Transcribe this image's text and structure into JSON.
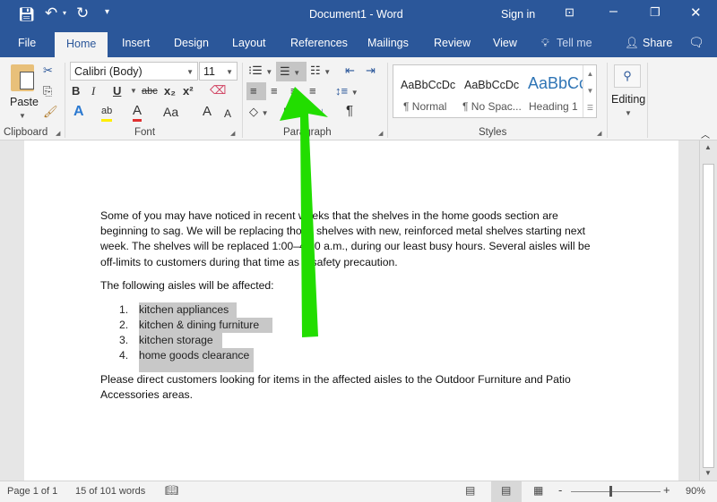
{
  "title": "Document1 - Word",
  "titlebar": {
    "sign_in": "Sign in",
    "save_icon": "save-icon",
    "undo_icon": "undo-icon",
    "redo_icon": "redo-icon"
  },
  "tabs": [
    {
      "label": "File"
    },
    {
      "label": "Home"
    },
    {
      "label": "Insert"
    },
    {
      "label": "Design"
    },
    {
      "label": "Layout"
    },
    {
      "label": "References"
    },
    {
      "label": "Mailings"
    },
    {
      "label": "Review"
    },
    {
      "label": "View"
    },
    {
      "label": "Tell me"
    }
  ],
  "share": "Share",
  "ribbon": {
    "clipboard": {
      "label": "Clipboard",
      "paste": "Paste"
    },
    "font": {
      "label": "Font",
      "name": "Calibri (Body)",
      "size": "11",
      "bold": "B",
      "italic": "I",
      "underline": "U",
      "strike": "abc",
      "sub": "x₂",
      "sup": "x²",
      "case": "Aa",
      "grow": "A",
      "shrink": "A",
      "effects": "A",
      "color": "A"
    },
    "paragraph": {
      "label": "Paragraph",
      "pilcrow": "¶"
    },
    "styles": {
      "label": "Styles",
      "items": [
        {
          "preview": "AaBbCcDc",
          "name": "¶ Normal"
        },
        {
          "preview": "AaBbCcDc",
          "name": "¶ No Spac..."
        },
        {
          "preview": "AaBbCc",
          "name": "Heading 1"
        }
      ]
    },
    "editing": {
      "label": "Editing"
    }
  },
  "document": {
    "para1": "Some of you may have noticed in recent weeks that the shelves in the home goods section are beginning to sag. We will be replacing those shelves with new, reinforced metal shelves starting next week. The shelves will be replaced 1:00–4:00 a.m., during our least busy hours. Several aisles will be off-limits to customers during that time as a safety precaution.",
    "para2": "The following aisles will be affected:",
    "list": [
      {
        "n": "1.",
        "t": "kitchen appliances"
      },
      {
        "n": "2.",
        "t": "kitchen & dining furniture"
      },
      {
        "n": "3.",
        "t": "kitchen storage"
      },
      {
        "n": "4.",
        "t": "home goods clearance"
      }
    ],
    "para3": "Please direct customers looking for items in the affected aisles to the Outdoor Furniture and Patio Accessories areas."
  },
  "status": {
    "page": "Page 1 of 1",
    "words": "15 of 101 words",
    "zoom": "90%",
    "zoom_fraction": 0.45
  },
  "colors": {
    "brand": "#2b579a",
    "arrow": "#22dd00"
  }
}
